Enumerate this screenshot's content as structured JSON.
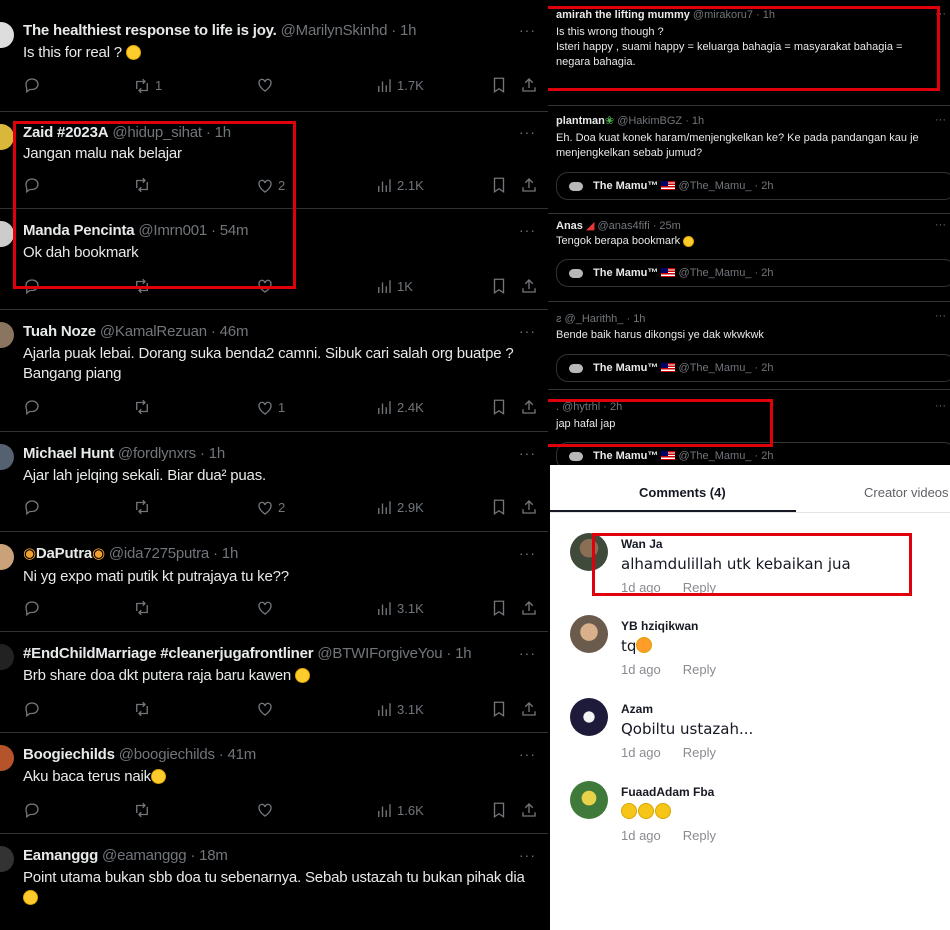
{
  "left_feed": {
    "tweets": [
      {
        "name": "The healthiest response to life is joy.",
        "handle": "@MarilynSkinhd",
        "time": "· 1h",
        "text": "Is this for real ?",
        "reply": "",
        "retweet": "1",
        "like": "",
        "views": "1.7K"
      },
      {
        "name": "Zaid #2023A",
        "handle": "@hidup_sihat",
        "time": "· 1h",
        "text": "Jangan malu nak belajar",
        "reply": "",
        "retweet": "",
        "like": "2",
        "views": "2.1K"
      },
      {
        "name": "Manda Pencinta",
        "handle": "@Imrn001",
        "time": "· 54m",
        "text": "Ok dah bookmark",
        "reply": "",
        "retweet": "",
        "like": "",
        "views": "1K"
      },
      {
        "name": "Tuah Noze",
        "handle": "@KamalRezuan",
        "time": "· 46m",
        "text": "Ajarla puak lebai. Dorang suka benda2 camni. Sibuk cari salah org buatpe ? Bangang piang",
        "reply": "",
        "retweet": "",
        "like": "1",
        "views": "2.4K"
      },
      {
        "name": "Michael Hunt",
        "handle": "@fordlynxrs",
        "time": "· 1h",
        "text": "Ajar lah jelqing sekali. Biar dua² puas.",
        "reply": "",
        "retweet": "",
        "like": "2",
        "views": "2.9K"
      },
      {
        "name": "DaPutra",
        "handle": "@ida7275putra",
        "time": "· 1h",
        "text": "Ni yg expo mati putik kt putrajaya tu ke??",
        "reply": "",
        "retweet": "",
        "like": "",
        "views": "3.1K"
      },
      {
        "name": "#EndChildMarriage #cleanerjugafrontliner",
        "handle": "@BTWIForgiveYou",
        "time": "· 1h",
        "text": "Brb share doa dkt putera raja baru kawen",
        "reply": "",
        "retweet": "",
        "like": "",
        "views": "3.1K"
      },
      {
        "name": "Boogiechilds",
        "handle": "@boogiechilds",
        "time": "· 41m",
        "text": "Aku baca terus naik",
        "reply": "",
        "retweet": "",
        "like": "",
        "views": "1.6K"
      },
      {
        "name": "Eamanggg",
        "handle": "@eamanggg",
        "time": "· 18m",
        "text": "Point utama bukan sbb doa tu sebenarnya. Sebab ustazah tu bukan pihak dia",
        "reply": "",
        "retweet": "",
        "like": "",
        "views": ""
      }
    ],
    "more_label": "···"
  },
  "replies_feed": {
    "posts": [
      {
        "name": "amirah the lifting mummy",
        "handle": "@mirakoru7 · 1h",
        "line1": "Is this wrong though ?",
        "line2": "Isteri happy , suami happy = keluarga bahagia = masyarakat bahagia = negara bahagia."
      },
      {
        "name": "plantman",
        "handle": "@HakimBGZ · 1h",
        "line1": "Eh. Doa kuat konek haram/menjengkelkan ke? Ke pada pandangan kau je menjengkelkan sebab jumud?"
      },
      {
        "name": "Anas",
        "handle": "@anas4fifi · 25m",
        "line1": "Tengok berapa bookmark"
      },
      {
        "name": "",
        "handle": "ƨ @_Harithh_ · 1h",
        "line1": "Bende baik harus dikongsi ye dak wkwkwk"
      },
      {
        "name": "",
        "handle": ". @hytrhl · 2h",
        "line1": "jap hafal jap"
      }
    ],
    "quote_name": "The Mamu™",
    "quote_handles": [
      "@The_Mamu_ · 2h",
      "@The_Mamu_ · 2h",
      "@The_Mamu_ · 2h",
      "@The_Mamu_ · 2h"
    ],
    "more_label": "···"
  },
  "comments_panel": {
    "tabs": [
      {
        "label": "Comments (4)"
      },
      {
        "label": "Creator videos"
      }
    ],
    "comments": [
      {
        "user": "Wan Ja",
        "text": "alhamdulillah utk kebaikan jua",
        "age": "1d ago",
        "reply": "Reply"
      },
      {
        "user": "YB hziqikwan",
        "text": "tq",
        "age": "1d ago",
        "reply": "Reply"
      },
      {
        "user": "Azam",
        "text": "Qobiltu ustazah...",
        "age": "1d ago",
        "reply": "Reply"
      },
      {
        "user": "FuaadAdam Fba",
        "text": "",
        "age": "1d ago",
        "reply": "Reply"
      }
    ]
  },
  "colors": {
    "highlight": "#e0000c",
    "muted": "#71767b",
    "text_dark_bg": "#e7e9ea"
  }
}
